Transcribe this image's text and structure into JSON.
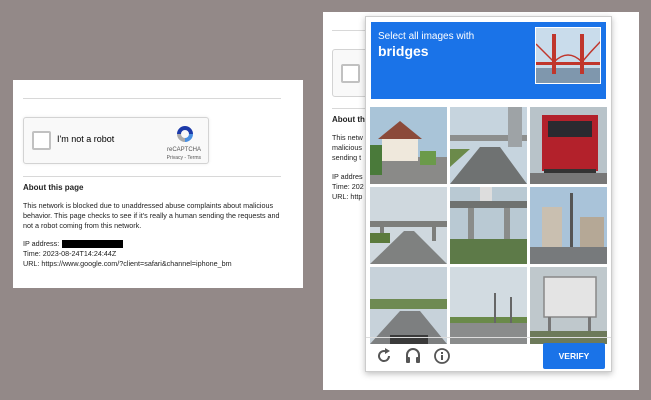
{
  "recaptcha_widget": {
    "label": "I'm not a robot",
    "brand": "reCAPTCHA",
    "links": "Privacy - Terms"
  },
  "about": {
    "title": "About this page",
    "body": "This network is blocked due to unaddressed abuse complaints about malicious behavior. This page checks to see if it's really a human sending the requests and not a robot coming from this network.",
    "ip_label": "IP address:",
    "time_line": "Time: 2023-08-24T14:24:44Z",
    "url_line": "URL: https://www.google.com/?client=safari&channel=iphone_bm"
  },
  "right_page": {
    "title_fragment": "About th",
    "body_fragments": [
      "This netw",
      "malicious",
      "sending t"
    ],
    "ip_fragment": "IP addres",
    "time_fragment": "Time: 202",
    "url_fragment": "URL: http"
  },
  "challenge": {
    "prompt": "Select all images with",
    "keyword": "bridges",
    "tiles": [
      "house-street",
      "highway-overpass",
      "red-truck",
      "road-overpass",
      "river-bridge",
      "city-street",
      "highway-sign",
      "empty-road",
      "road-sign"
    ],
    "verify_label": "VERIFY",
    "colors": {
      "header": "#1a73e8",
      "button": "#1a73e8"
    }
  }
}
